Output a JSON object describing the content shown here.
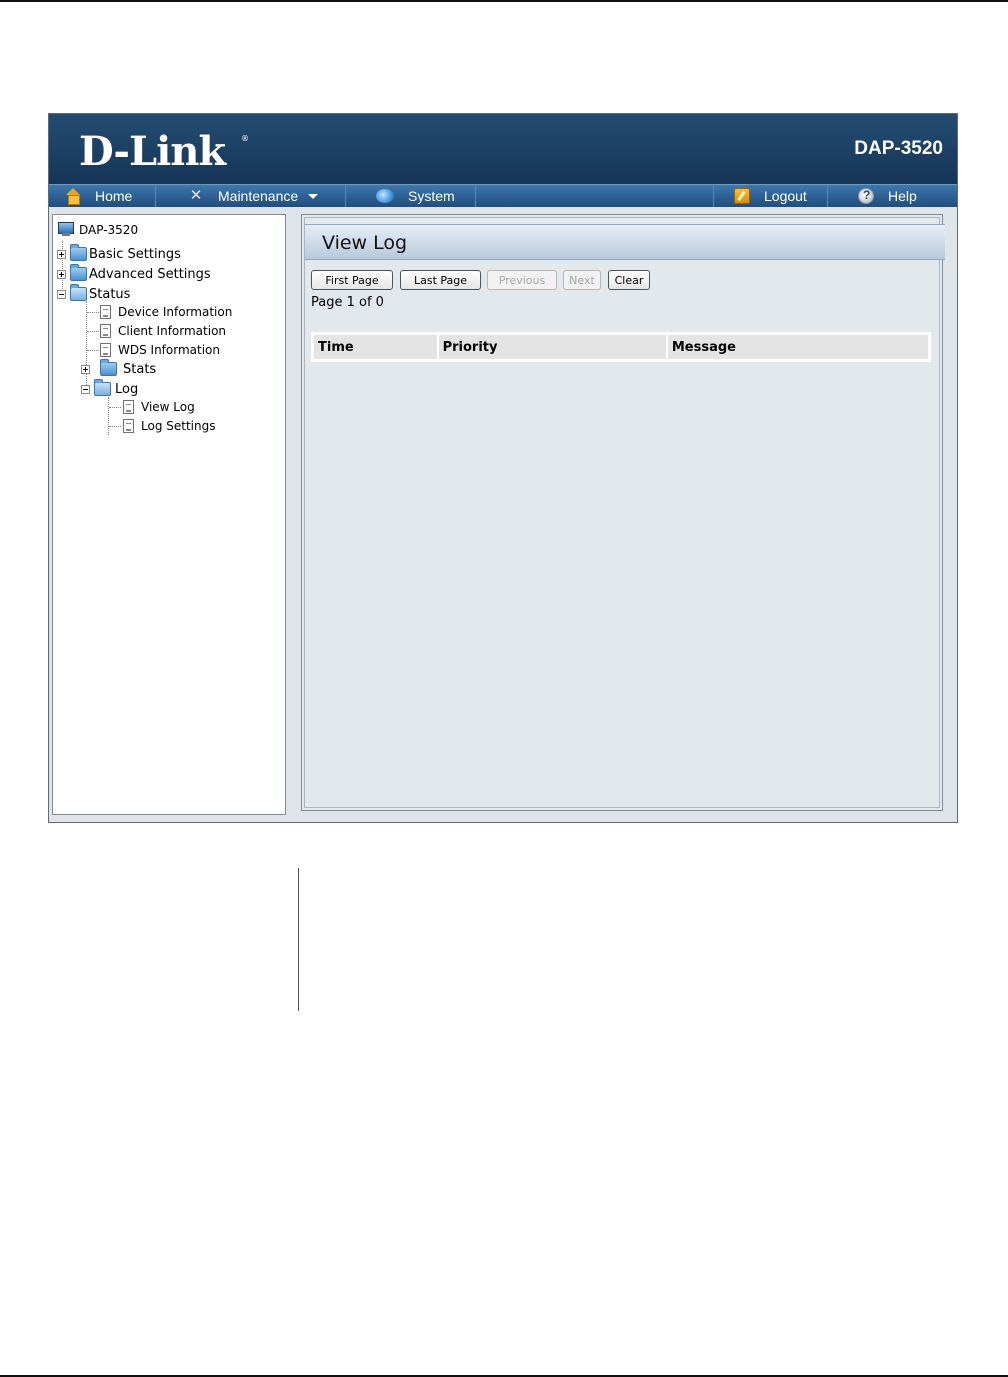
{
  "banner": {
    "logo": "D-Link",
    "logo_mark": "®",
    "model": "DAP-3520"
  },
  "nav": {
    "home": "Home",
    "maintenance": "Maintenance",
    "system": "System",
    "logout": "Logout",
    "help": "Help"
  },
  "tree": {
    "root": "DAP-3520",
    "basic_settings": "Basic Settings",
    "advanced_settings": "Advanced Settings",
    "status": "Status",
    "device_information": "Device Information",
    "client_information": "Client Information",
    "wds_information": "WDS Information",
    "stats": "Stats",
    "log": "Log",
    "view_log": "View Log",
    "log_settings": "Log Settings"
  },
  "content": {
    "title": "View Log",
    "buttons": {
      "first_page": "First Page",
      "last_page": "Last Page",
      "previous": "Previous",
      "next": "Next",
      "clear": "Clear"
    },
    "page_info": "Page 1 of 0",
    "columns": [
      "Time",
      "Priority",
      "Message"
    ]
  }
}
